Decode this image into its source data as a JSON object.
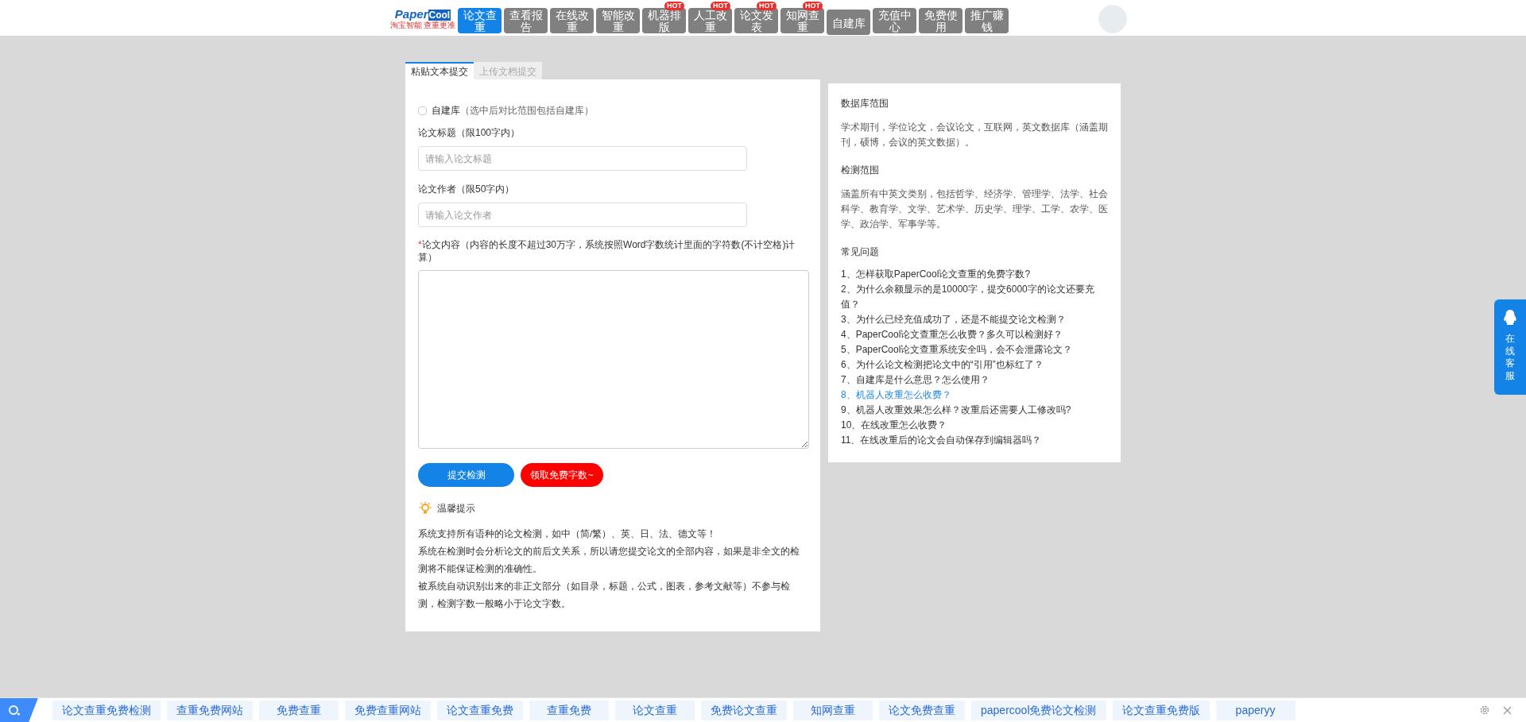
{
  "logo": {
    "text_1": "Paper",
    "text_2": "Cool",
    "tagline": "淘宝智能 查重更准"
  },
  "nav": [
    {
      "label": "论文查重",
      "selected": true
    },
    {
      "label": "查看报告",
      "selected": false
    },
    {
      "label": "在线改重",
      "selected": false
    },
    {
      "label": "智能改重",
      "selected": false
    },
    {
      "label": "机器排版",
      "selected": false,
      "hot": "HOT"
    },
    {
      "label": "人工改重",
      "selected": false,
      "hot": "HOT"
    },
    {
      "label": "论文发表",
      "selected": false,
      "hot": "HOT"
    },
    {
      "label": "知网查重",
      "selected": false,
      "hot": "HOT"
    },
    {
      "label": "自建库",
      "selected": false
    },
    {
      "label": "充值中心",
      "selected": false
    },
    {
      "label": "免费使用",
      "selected": false
    },
    {
      "label": "推广赚钱",
      "selected": false
    }
  ],
  "tabs": [
    {
      "label": "粘贴文本提交",
      "selected": true
    },
    {
      "label": "上传文档提交",
      "selected": false
    }
  ],
  "own_library": {
    "label": "自建库",
    "note": "（选中后对比范围包括自建库）",
    "checked": false
  },
  "title_field": {
    "label": "论文标题（限100字内）",
    "placeholder": "请输入论文标题"
  },
  "author_field": {
    "label": "论文作者（限50字内）",
    "placeholder": "请输入论文作者"
  },
  "content_field": {
    "required_mark": "*",
    "label": "论文内容（内容的长度不超过30万字，系统按照Word字数统计里面的字符数(不计空格)计算）"
  },
  "buttons": [
    {
      "label": "提交检测",
      "kind": "primary"
    },
    {
      "label": "领取免费字数~",
      "kind": "danger"
    }
  ],
  "tips": {
    "title": "温馨提示",
    "lines": [
      "系统支持所有语种的论文检测，如中（简/繁）、英、日、法、德文等！",
      "系统在检测时会分析论文的前后文关系，所以请您提交论文的全部内容，如果是非全文的检测将不能保证检测的准确性。",
      "被系统自动识别出来的非正文部分（如目录，标题，公式，图表，参考文献等）不参与检测，检测字数一般略小于论文字数。"
    ]
  },
  "info": [
    {
      "heading": "数据库范围",
      "text": "学术期刊，学位论文，会议论文，互联网，英文数据库（涵盖期刊，硕博，会议的英文数据）。"
    },
    {
      "heading": "检测范围",
      "text": "涵盖所有中英文类别，包括哲学、经济学、管理学、法学、社会科学、教育学、文学、艺术学、历史学、理学、工学、农学、医学、政治学、军事学等。"
    }
  ],
  "faq": {
    "heading": "常见问题",
    "items": [
      {
        "text": "1、怎样获取PaperCool论文查重的免费字数?",
        "selected": false
      },
      {
        "text": "2、为什么余额显示的是10000字，提交6000字的论文还要充值？",
        "selected": false
      },
      {
        "text": "3、为什么已经充值成功了，还是不能提交论文检测？",
        "selected": false
      },
      {
        "text": "4、PaperCool论文查重怎么收费？多久可以检测好？",
        "selected": false
      },
      {
        "text": "5、PaperCool论文查重系统安全吗，会不会泄露论文？",
        "selected": false
      },
      {
        "text": "6、为什么论文检测把论文中的“引用”也标红了？",
        "selected": false
      },
      {
        "text": "7、自建库是什么意思？怎么使用？",
        "selected": false
      },
      {
        "text": "8、机器人改重怎么收费？",
        "selected": true
      },
      {
        "text": "9、机器人改重效果怎么样？改重后还需要人工修改吗?",
        "selected": false
      },
      {
        "text": "10、在线改重怎么收费？",
        "selected": false
      },
      {
        "text": "11、在线改重后的论文会自动保存到编辑器吗？",
        "selected": false
      }
    ]
  },
  "service": {
    "label": "在线客服"
  },
  "bottom_links": [
    "论文查重免费检测",
    "查重免费网站",
    "免费查重",
    "免费查重网站",
    "论文查重免费",
    "查重免费",
    "论文查重",
    "免费论文查重",
    "知网查重",
    "论文免费查重",
    "papercool免费论文检测",
    "论文查重免费版",
    "paperyy"
  ]
}
